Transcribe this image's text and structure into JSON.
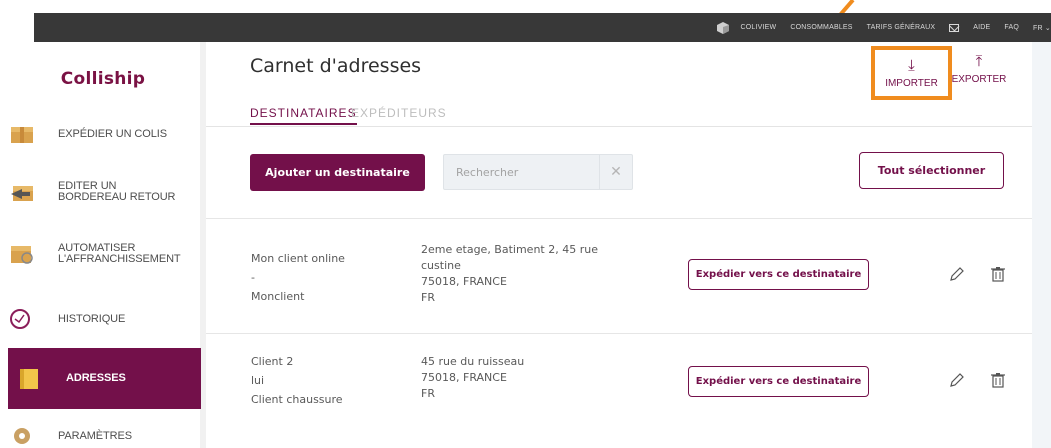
{
  "topnav": {
    "items": [
      "COLIVIEW",
      "CONSOMMABLES",
      "TARIFS GÉNÉRAUX",
      "AIDE",
      "FAQ"
    ],
    "lang": "FR"
  },
  "sidebar": {
    "brand": "Colliship",
    "items": [
      {
        "label": "EXPÉDIER UN COLIS",
        "icon": "parcel-icon"
      },
      {
        "label": "EDITER UN BORDEREAU RETOUR",
        "icon": "return-parcel-icon"
      },
      {
        "label": "AUTOMATISER L'AFFRANCHISSEMENT",
        "icon": "auto-parcel-icon"
      },
      {
        "label": "HISTORIQUE",
        "icon": "clock-icon"
      },
      {
        "label": "ADRESSES",
        "icon": "address-icon",
        "active": true
      },
      {
        "label": "PARAMÈTRES",
        "icon": "gear-icon"
      }
    ]
  },
  "main": {
    "title": "Carnet d'adresses",
    "tabs": [
      {
        "label": "DESTINATAIRES",
        "active": true
      },
      {
        "label": "EXPÉDITEURS",
        "active": false
      }
    ],
    "tools": {
      "import_label": "IMPORTER",
      "export_label": "EXPORTER"
    },
    "add_button": "Ajouter un destinataire",
    "search_placeholder": "Rechercher",
    "select_all": "Tout sélectionner",
    "rows": [
      {
        "name_lines": [
          "Mon client online",
          "-",
          "Monclient"
        ],
        "address_lines": [
          "2eme etage, Batiment 2, 45 rue",
          "custine",
          "75018, FRANCE",
          "FR"
        ],
        "ship_label": "Expédier vers ce destinataire"
      },
      {
        "name_lines": [
          "Client 2",
          "lui",
          "Client chaussure"
        ],
        "address_lines": [
          "45 rue du ruisseau",
          "75018, FRANCE",
          "FR"
        ],
        "ship_label": "Expédier vers ce destinataire"
      }
    ]
  },
  "colors": {
    "brand": "#73104a",
    "highlight": "#f08c1e",
    "topbar": "#383838"
  }
}
